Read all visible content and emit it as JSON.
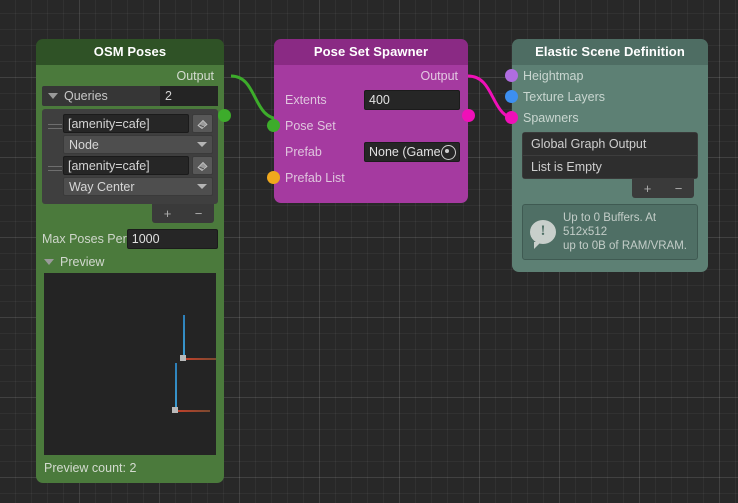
{
  "nodes": {
    "osm": {
      "title": "OSM Poses",
      "output_label": "Output",
      "queries": {
        "label": "Queries",
        "count": "2",
        "items": [
          {
            "filter": "[amenity=cafe]",
            "mode": "Node"
          },
          {
            "filter": "[amenity=cafe]",
            "mode": "Way Center"
          }
        ],
        "add_label": "+",
        "remove_label": "−"
      },
      "max_poses": {
        "label": "Max Poses Per",
        "value": "1000"
      },
      "preview": {
        "label": "Preview",
        "count_label": "Preview count: 2"
      }
    },
    "spawner": {
      "title": "Pose Set Spawner",
      "output_label": "Output",
      "extents": {
        "label": "Extents",
        "value": "400"
      },
      "pose_set_label": "Pose Set",
      "prefab": {
        "label": "Prefab",
        "value": "None (Game"
      },
      "prefab_list_label": "Prefab List"
    },
    "scene": {
      "title": "Elastic Scene Definition",
      "inputs": [
        {
          "label": "Heightmap",
          "color": "#b06de0"
        },
        {
          "label": "Texture Layers",
          "color": "#3d8ff0"
        },
        {
          "label": "Spawners",
          "color": "#f010b8"
        }
      ],
      "list": {
        "header": "Global Graph Output",
        "empty_label": "List is Empty"
      },
      "add_label": "+",
      "remove_label": "−",
      "info": {
        "line1": "Up to 0 Buffers. At 512x512",
        "line2": "up to 0B of RAM/VRAM."
      }
    }
  },
  "colors": {
    "canvas": "#282828",
    "port_green": "#3dac2b",
    "port_orange": "#f0a81e",
    "port_magenta": "#f010b8",
    "wire_green": "#3dac2b",
    "wire_magenta": "#f010b8"
  }
}
